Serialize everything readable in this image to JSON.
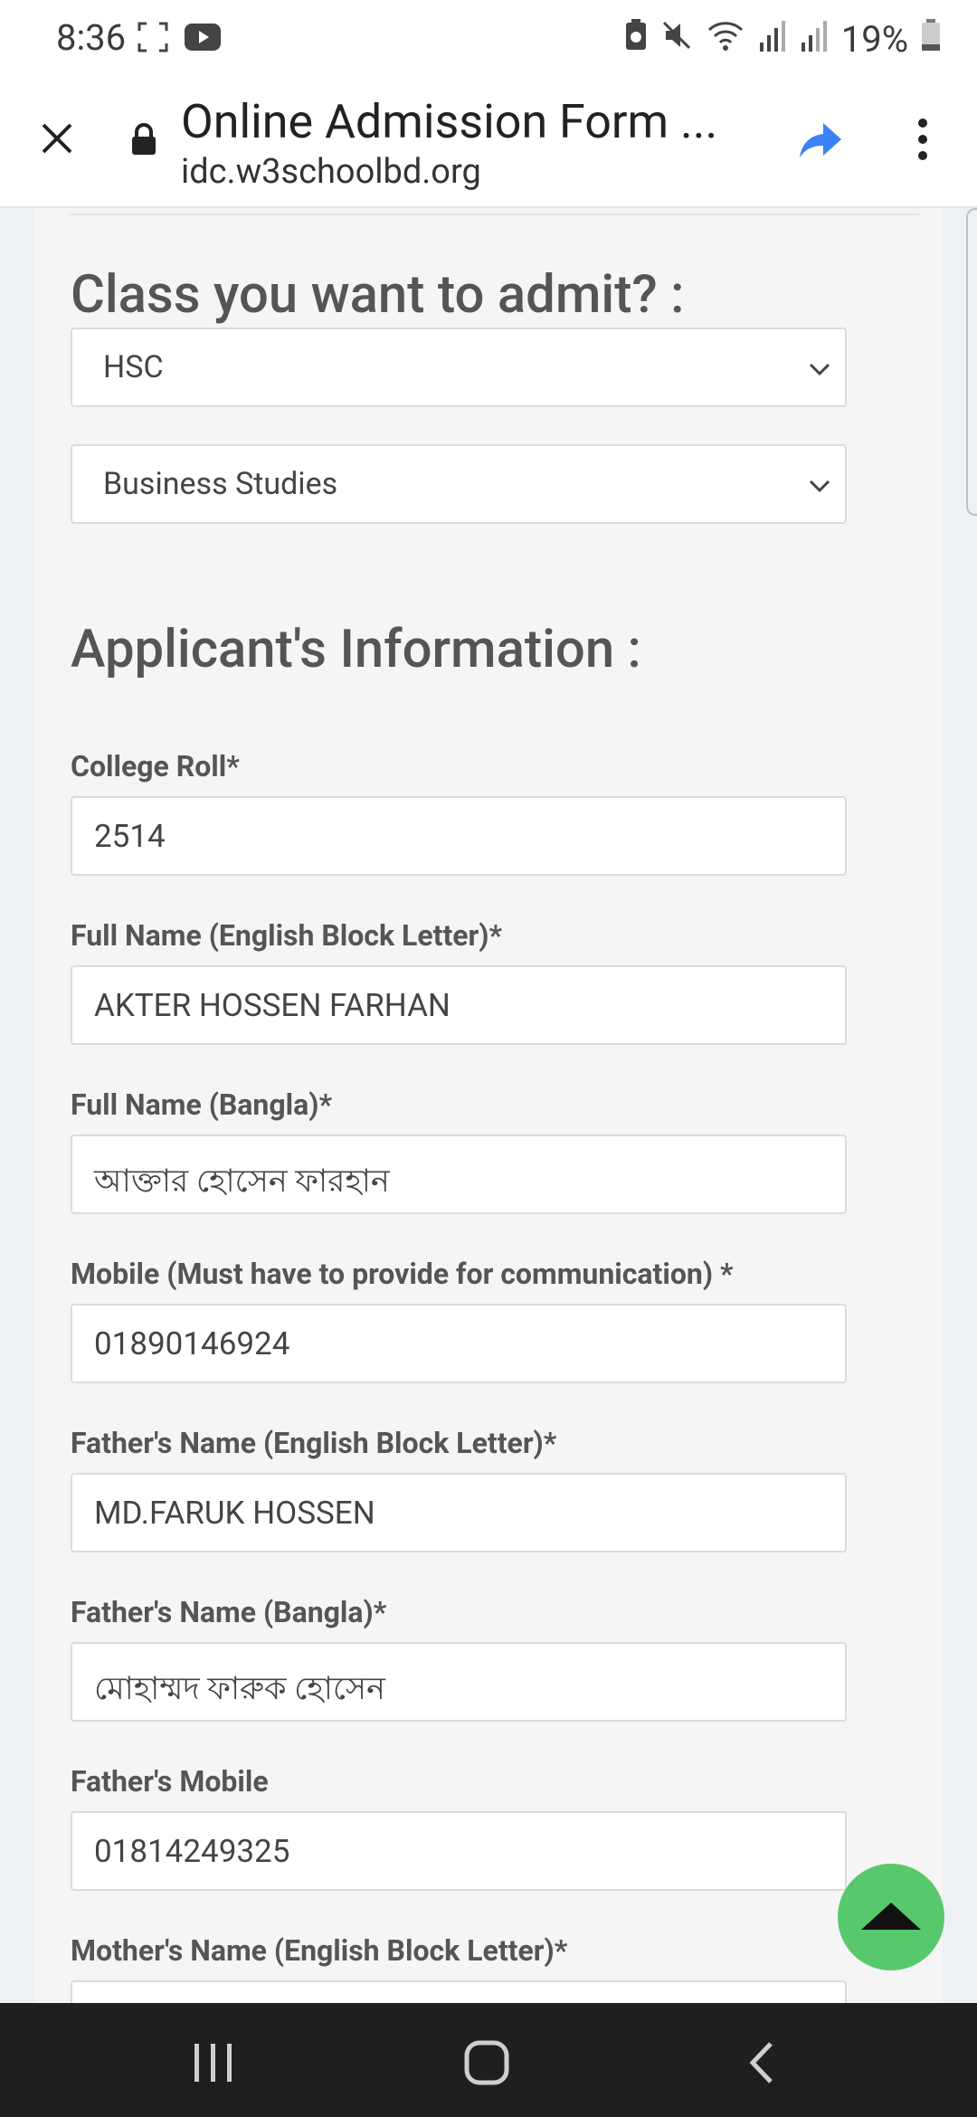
{
  "status_bar": {
    "time": "8:36",
    "battery": "19%",
    "icons": [
      "screenshot-icon",
      "youtube-icon",
      "battery-saver-icon",
      "mute-icon",
      "wifi-icon",
      "signal-icon",
      "signal-icon",
      "battery-icon"
    ]
  },
  "toolbar": {
    "title": "Online Admission Form ...",
    "url": "idc.w3schoolbd.org",
    "accent_color": "#3b82f6"
  },
  "form": {
    "class_heading": "Class you want to admit? :",
    "class_select": "HSC",
    "group_select": "Business Studies",
    "applicant_heading": "Applicant's Information :",
    "fields": [
      {
        "label": "College Roll*",
        "value": "2514"
      },
      {
        "label": "Full Name (English Block Letter)*",
        "value": "AKTER HOSSEN FARHAN"
      },
      {
        "label": "Full Name (Bangla)*",
        "value": "আক্তার হোসেন ফারহান"
      },
      {
        "label": "Mobile (Must have to provide for communication) *",
        "value": "01890146924"
      },
      {
        "label": "Father's Name (English Block Letter)*",
        "value": "MD.FARUK HOSSEN"
      },
      {
        "label": "Father's Name (Bangla)*",
        "value": "মোহাম্মদ ফারুক হোসেন"
      },
      {
        "label": "Father's Mobile",
        "value": "01814249325"
      },
      {
        "label": "Mother's Name (English Block Letter)*",
        "value": ""
      }
    ]
  },
  "scroll_top_color": "#58c86d"
}
